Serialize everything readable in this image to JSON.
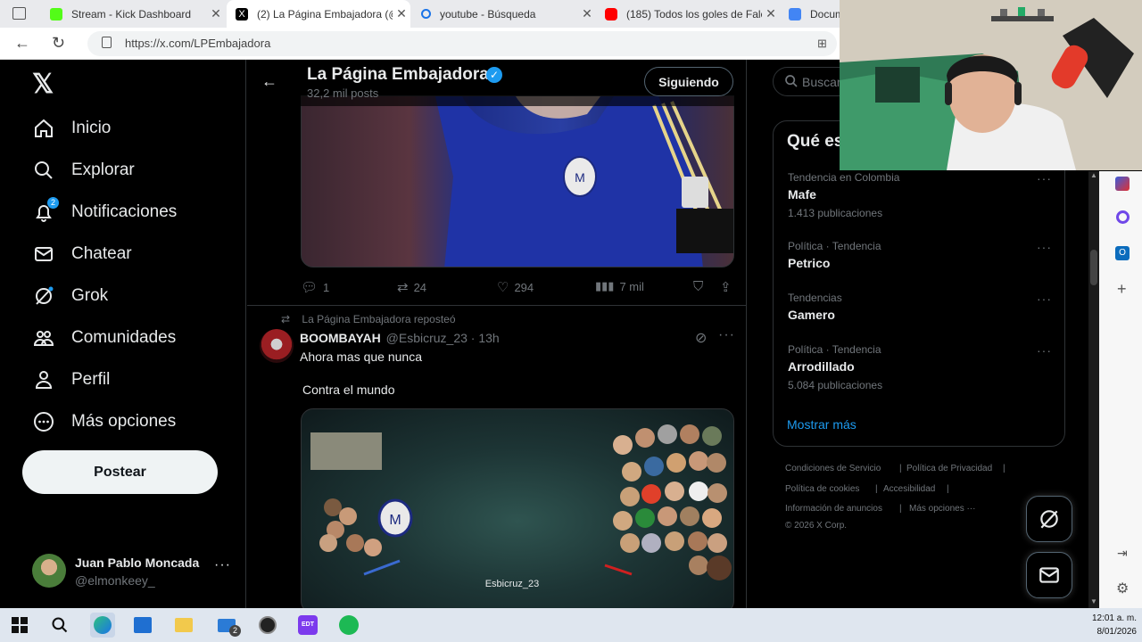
{
  "browser": {
    "tabs": [
      {
        "title": "Stream - Kick Dashboard",
        "color": "#53fc18"
      },
      {
        "title": "(2) La Página Embajadora (@L",
        "color": "#000000"
      },
      {
        "title": "youtube - Búsqueda",
        "color": "#1a73e8"
      },
      {
        "title": "(185) Todos los goles de Falca",
        "color": "#ff0000"
      },
      {
        "title": "Docum",
        "color": "#4285f4"
      }
    ],
    "url": "https://x.com/LPEmbajadora"
  },
  "nav": {
    "items": [
      {
        "label": "Inicio",
        "icon": "home-icon"
      },
      {
        "label": "Explorar",
        "icon": "search-icon"
      },
      {
        "label": "Notificaciones",
        "icon": "bell-icon",
        "badge": "2"
      },
      {
        "label": "Chatear",
        "icon": "mail-icon"
      },
      {
        "label": "Grok",
        "icon": "grok-icon"
      },
      {
        "label": "Comunidades",
        "icon": "communities-icon"
      },
      {
        "label": "Perfil",
        "icon": "person-icon"
      },
      {
        "label": "Más opciones",
        "icon": "more-circle-icon"
      }
    ],
    "post_label": "Postear",
    "account": {
      "name": "Juan Pablo Moncada",
      "handle": "@elmonkeey_"
    }
  },
  "profile_header": {
    "name": "La Página Embajadora",
    "posts": "32,2 mil posts",
    "follow_label": "Siguiendo"
  },
  "tweet1": {
    "replies": "1",
    "reposts": "24",
    "likes": "294",
    "views": "7 mil"
  },
  "tweet2": {
    "repost_context": "La Página Embajadora reposteó",
    "author": "BOOMBAYAH",
    "handle_time": "@Esbicruz_23 · 13h",
    "text_line1": "Ahora mas que nunca",
    "text_line2": "Contra el mundo",
    "watermark": "Esbicruz_23"
  },
  "right": {
    "search_placeholder": "Buscar",
    "trends_title": "Qué es",
    "trends": [
      {
        "context": "Tendencia en Colombia",
        "name": "Mafe",
        "count": "1.413 publicaciones"
      },
      {
        "context": "Política · Tendencia",
        "name": "Petrico",
        "count": ""
      },
      {
        "context": "Tendencias",
        "name": "Gamero",
        "count": ""
      },
      {
        "context": "Política · Tendencia",
        "name": "Arrodillado",
        "count": "5.084 publicaciones"
      }
    ],
    "show_more": "Mostrar más",
    "footer": {
      "terms": "Condiciones de Servicio",
      "privacy": "Política de Privacidad",
      "cookies": "Política de cookies",
      "access": "Accesibilidad",
      "ads": "Información de anuncios",
      "more": "Más opciones ···",
      "copyright": "© 2026 X Corp."
    }
  },
  "taskbar": {
    "time": "12:01 a. m.",
    "date": "8/01/2026",
    "mail_badge": "2"
  },
  "colors": {
    "accent": "#1d9bf0",
    "verified": "#1d9bf0",
    "background": "#000000",
    "border": "#2f3336",
    "muted": "#71767b"
  }
}
